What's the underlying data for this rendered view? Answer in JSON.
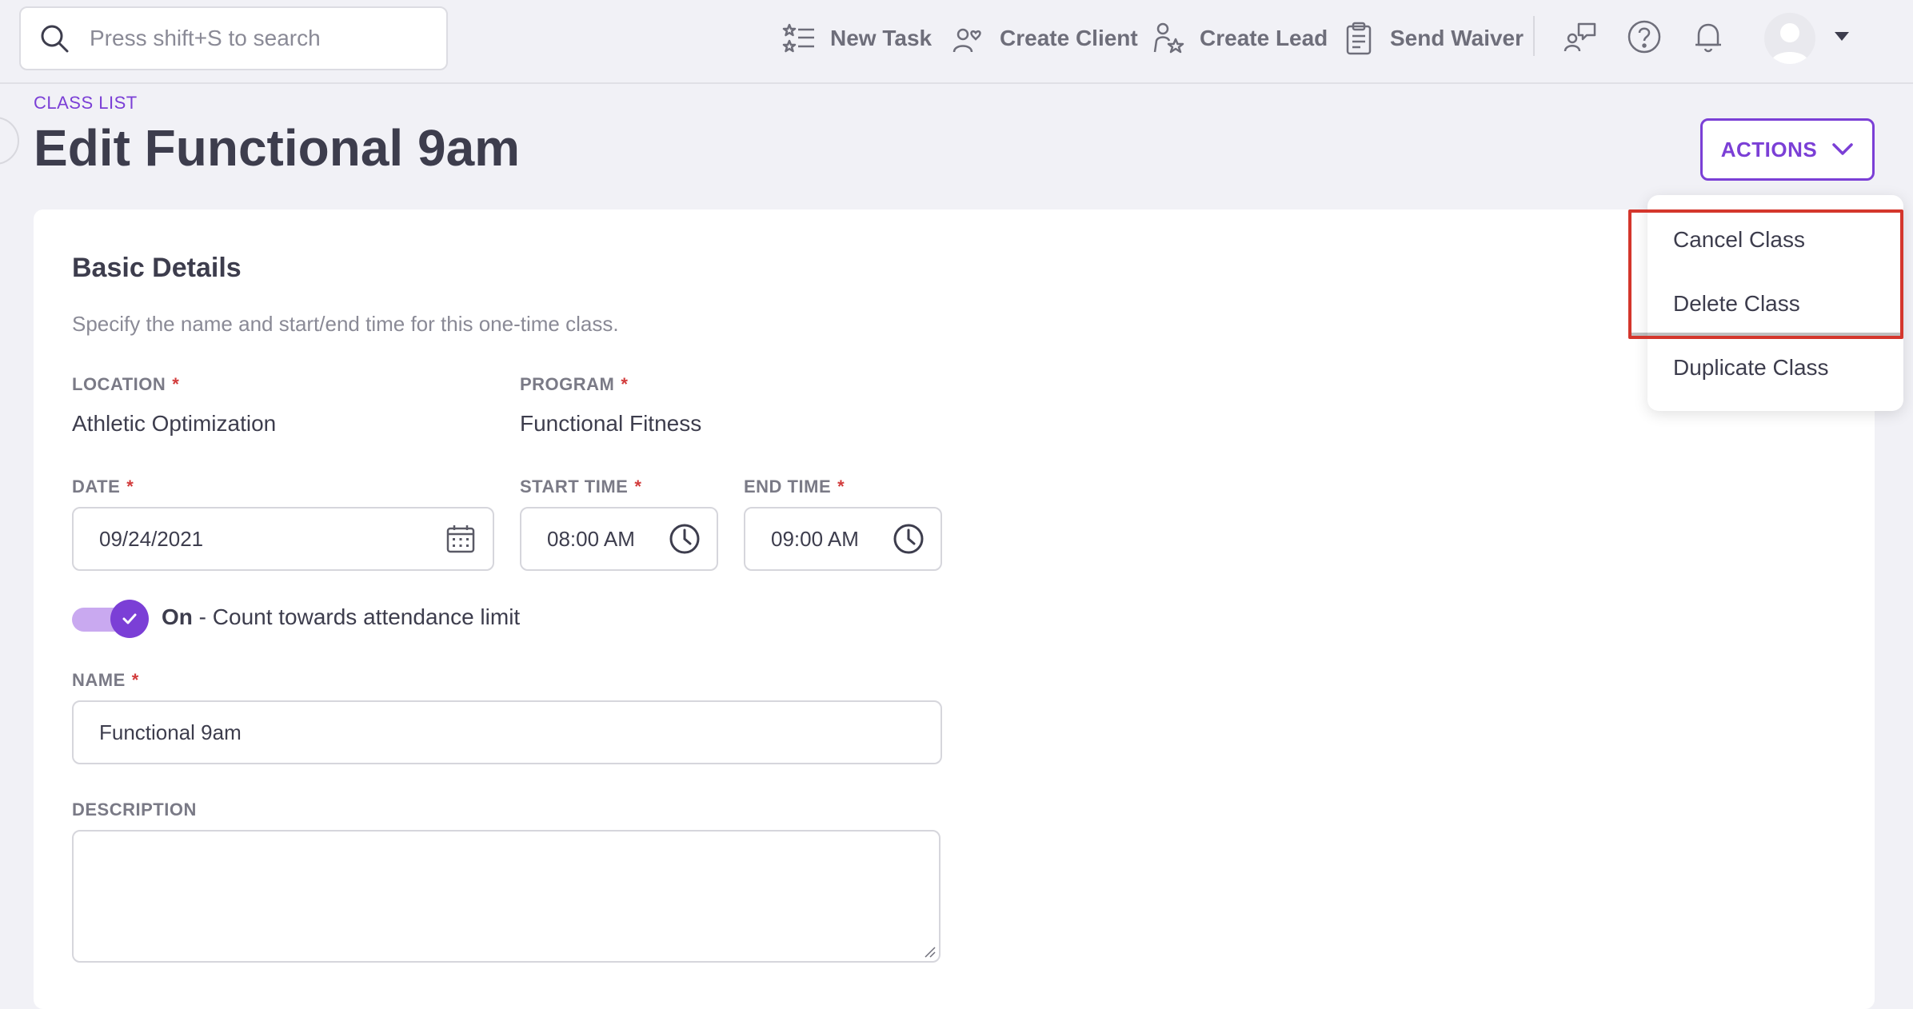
{
  "topbar": {
    "search_placeholder": "Press shift+S to search",
    "actions": [
      "New Task",
      "Create Client",
      "Create Lead",
      "Send Waiver"
    ]
  },
  "header": {
    "breadcrumb": "CLASS LIST",
    "title": "Edit Functional 9am",
    "actions_label": "ACTIONS"
  },
  "dropdown": {
    "items": [
      "Cancel Class",
      "Delete Class",
      "Duplicate Class"
    ]
  },
  "form": {
    "section_title": "Basic Details",
    "section_desc": "Specify the name and start/end time for this one-time class.",
    "location_label": "LOCATION",
    "location_value": "Athletic Optimization",
    "program_label": "PROGRAM",
    "program_value": "Functional Fitness",
    "date_label": "DATE",
    "date_value": "09/24/2021",
    "start_label": "START TIME",
    "start_value": "08:00 AM",
    "end_label": "END TIME",
    "end_value": "09:00 AM",
    "toggle_state": "On",
    "toggle_text": " - Count towards attendance limit",
    "name_label": "NAME",
    "name_value": "Functional 9am",
    "description_label": "DESCRIPTION",
    "required_mark": "*"
  },
  "colors": {
    "accent": "#7b3fd6",
    "required": "#d23b3b",
    "highlight": "#d4362c"
  }
}
